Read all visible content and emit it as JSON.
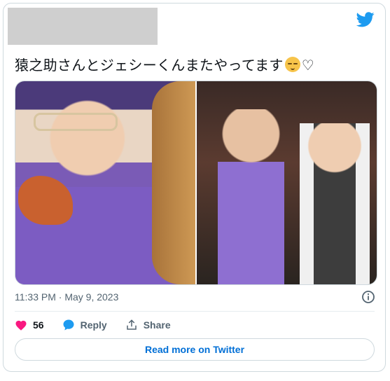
{
  "tweet": {
    "text": "猿之助さんとジェシーくんまたやってます",
    "trailing_symbol": "♡",
    "emoji": "pensive-face-emoji",
    "timestamp": "11:33 PM · May 9, 2023"
  },
  "actions": {
    "like_count": "56",
    "reply_label": "Reply",
    "share_label": "Share"
  },
  "read_more_label": "Read more on Twitter",
  "colors": {
    "twitter_blue": "#1d9bf0",
    "like_pink": "#f91880",
    "link_blue": "#006fd6",
    "secondary_text": "#536471",
    "border": "#cfd9de"
  }
}
